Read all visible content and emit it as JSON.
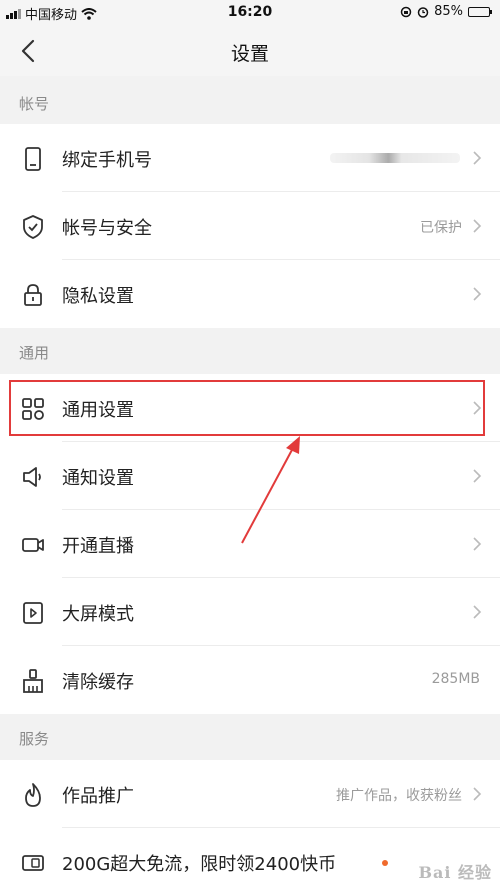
{
  "status_bar": {
    "carrier": "中国移动",
    "time": "16:20",
    "battery": "85%",
    "battery_level": 0.85
  },
  "nav": {
    "back_icon": "chevron-left-icon",
    "title": "设置"
  },
  "sections": {
    "account": "帐号",
    "general": "通用",
    "services": "服务"
  },
  "rows": {
    "bind_phone": {
      "label": "绑定手机号",
      "icon": "phone-icon"
    },
    "account_security": {
      "label": "帐号与安全",
      "value": "已保护",
      "icon": "shield-icon"
    },
    "privacy": {
      "label": "隐私设置",
      "icon": "lock-icon"
    },
    "general_settings": {
      "label": "通用设置",
      "icon": "grid-icon"
    },
    "notifications": {
      "label": "通知设置",
      "icon": "speaker-icon"
    },
    "live": {
      "label": "开通直播",
      "icon": "video-icon"
    },
    "big_screen": {
      "label": "大屏模式",
      "icon": "play-box-icon"
    },
    "clear_cache": {
      "label": "清除缓存",
      "value": "285MB",
      "icon": "broom-icon"
    },
    "promote": {
      "label": "作品推广",
      "value": "推广作品，收获粉丝",
      "icon": "flame-icon"
    },
    "free_data": {
      "label": "200G超大免流，限时领2400快币",
      "icon": "sim-card-icon"
    }
  },
  "colors": {
    "highlight": "#e23b3b",
    "notify_dot": "#f06a2c"
  },
  "watermark": "Bai 经验"
}
